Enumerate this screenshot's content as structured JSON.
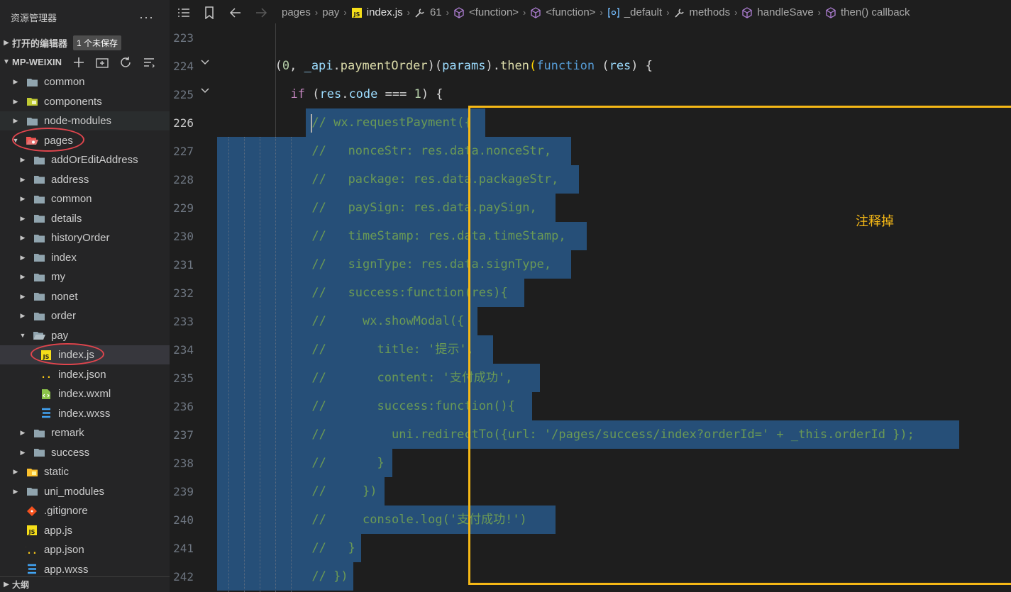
{
  "sidebar": {
    "title": "资源管理器",
    "more_label": "···",
    "open_editors": {
      "label": "打开的编辑器",
      "badge": "1 个未保存"
    },
    "project": {
      "label": "MP-WEIXIN"
    },
    "outline_label": "大纲",
    "tree": [
      {
        "name": "common",
        "kind": "folder",
        "depth": 0,
        "expanded": false
      },
      {
        "name": "components",
        "kind": "folder-comp",
        "depth": 0,
        "expanded": false
      },
      {
        "name": "node-modules",
        "kind": "folder",
        "depth": 0,
        "expanded": false
      },
      {
        "name": "pages",
        "kind": "folder-pages",
        "depth": 0,
        "expanded": true
      },
      {
        "name": "addOrEditAddress",
        "kind": "folder",
        "depth": 1,
        "expanded": false
      },
      {
        "name": "address",
        "kind": "folder",
        "depth": 1,
        "expanded": false
      },
      {
        "name": "common",
        "kind": "folder",
        "depth": 1,
        "expanded": false
      },
      {
        "name": "details",
        "kind": "folder",
        "depth": 1,
        "expanded": false
      },
      {
        "name": "historyOrder",
        "kind": "folder",
        "depth": 1,
        "expanded": false
      },
      {
        "name": "index",
        "kind": "folder",
        "depth": 1,
        "expanded": false
      },
      {
        "name": "my",
        "kind": "folder",
        "depth": 1,
        "expanded": false
      },
      {
        "name": "nonet",
        "kind": "folder",
        "depth": 1,
        "expanded": false
      },
      {
        "name": "order",
        "kind": "folder",
        "depth": 1,
        "expanded": false
      },
      {
        "name": "pay",
        "kind": "folder-open",
        "depth": 1,
        "expanded": true
      },
      {
        "name": "index.js",
        "kind": "js",
        "depth": 2,
        "selected": true
      },
      {
        "name": "index.json",
        "kind": "json",
        "depth": 2
      },
      {
        "name": "index.wxml",
        "kind": "wxml",
        "depth": 2
      },
      {
        "name": "index.wxss",
        "kind": "css",
        "depth": 2
      },
      {
        "name": "remark",
        "kind": "folder",
        "depth": 1,
        "expanded": false
      },
      {
        "name": "success",
        "kind": "folder",
        "depth": 1,
        "expanded": false
      },
      {
        "name": "static",
        "kind": "folder-static",
        "depth": 0,
        "expanded": false
      },
      {
        "name": "uni_modules",
        "kind": "folder",
        "depth": 0,
        "expanded": false
      },
      {
        "name": ".gitignore",
        "kind": "git",
        "depth": 0
      },
      {
        "name": "app.js",
        "kind": "js",
        "depth": 0
      },
      {
        "name": "app.json",
        "kind": "json",
        "depth": 0
      },
      {
        "name": "app.wxss",
        "kind": "css",
        "depth": 0
      }
    ]
  },
  "breadcrumb": [
    {
      "label": "pages",
      "icon": ""
    },
    {
      "label": "pay",
      "icon": ""
    },
    {
      "label": "index.js",
      "icon": "js-file-icon"
    },
    {
      "label": "61",
      "icon": "wrench-icon"
    },
    {
      "label": "<function>",
      "icon": "cube-icon"
    },
    {
      "label": "<function>",
      "icon": "cube-icon"
    },
    {
      "label": "_default",
      "icon": "object-icon"
    },
    {
      "label": "methods",
      "icon": "wrench-icon"
    },
    {
      "label": "handleSave",
      "icon": "cube-icon"
    },
    {
      "label": "then() callback",
      "icon": "cube-icon"
    }
  ],
  "editor": {
    "active_line": 226,
    "lines": [
      {
        "n": 223,
        "tokens": []
      },
      {
        "n": 224,
        "tokens": [
          [
            "t-punc",
            "("
          ],
          [
            "t-num",
            "0"
          ],
          [
            "t-punc",
            ", "
          ],
          [
            "t-var",
            "_api"
          ],
          [
            "t-punc",
            "."
          ],
          [
            "t-fn",
            "paymentOrder"
          ],
          [
            "t-punc",
            ")("
          ],
          [
            "t-var",
            "params"
          ],
          [
            "t-punc",
            ")."
          ],
          [
            "t-fn",
            "then"
          ],
          [
            "t-yel",
            "("
          ],
          [
            "t-kw",
            "function"
          ],
          [
            "t-punc",
            " ("
          ],
          [
            "t-var",
            "res"
          ],
          [
            "t-punc",
            ") {"
          ]
        ]
      },
      {
        "n": 225,
        "tokens": [
          [
            "t-ctl",
            "if"
          ],
          [
            "t-punc",
            " ("
          ],
          [
            "t-var",
            "res"
          ],
          [
            "t-punc",
            "."
          ],
          [
            "t-var",
            "code"
          ],
          [
            "t-punc",
            " === "
          ],
          [
            "t-num",
            "1"
          ],
          [
            "t-punc",
            ") {"
          ]
        ]
      },
      {
        "n": 226,
        "tokens": [
          [
            "t-cm",
            "// wx.requestPayment({"
          ]
        ]
      },
      {
        "n": 227,
        "tokens": [
          [
            "t-cm",
            "//   nonceStr: res.data.nonceStr,"
          ]
        ]
      },
      {
        "n": 228,
        "tokens": [
          [
            "t-cm",
            "//   package: res.data.packageStr,"
          ]
        ]
      },
      {
        "n": 229,
        "tokens": [
          [
            "t-cm",
            "//   paySign: res.data.paySign,"
          ]
        ]
      },
      {
        "n": 230,
        "tokens": [
          [
            "t-cm",
            "//   timeStamp: res.data.timeStamp,"
          ]
        ]
      },
      {
        "n": 231,
        "tokens": [
          [
            "t-cm",
            "//   signType: res.data.signType,"
          ]
        ]
      },
      {
        "n": 232,
        "tokens": [
          [
            "t-cm",
            "//   success:function(res){"
          ]
        ]
      },
      {
        "n": 233,
        "tokens": [
          [
            "t-cm",
            "//     wx.showModal({"
          ]
        ]
      },
      {
        "n": 234,
        "tokens": [
          [
            "t-cm",
            "//       title: '提示',"
          ]
        ]
      },
      {
        "n": 235,
        "tokens": [
          [
            "t-cm",
            "//       content: '支付成功',"
          ]
        ]
      },
      {
        "n": 236,
        "tokens": [
          [
            "t-cm",
            "//       success:function(){"
          ]
        ]
      },
      {
        "n": 237,
        "tokens": [
          [
            "t-cm",
            "//         uni.redirectTo({url: '/pages/success/index?orderId=' + _this.orderId });"
          ]
        ]
      },
      {
        "n": 238,
        "tokens": [
          [
            "t-cm",
            "//       }"
          ]
        ]
      },
      {
        "n": 239,
        "tokens": [
          [
            "t-cm",
            "//     })"
          ]
        ]
      },
      {
        "n": 240,
        "tokens": [
          [
            "t-cm",
            "//     console.log('支付成功!')"
          ]
        ]
      },
      {
        "n": 241,
        "tokens": [
          [
            "t-cm",
            "//   }"
          ]
        ]
      },
      {
        "n": 242,
        "tokens": [
          [
            "t-cm",
            "// })"
          ]
        ]
      }
    ]
  },
  "annotation": {
    "text": "注释掉",
    "color": "#f5b816"
  },
  "colors": {
    "selection": "#264f78",
    "circle": "#e0454d"
  }
}
